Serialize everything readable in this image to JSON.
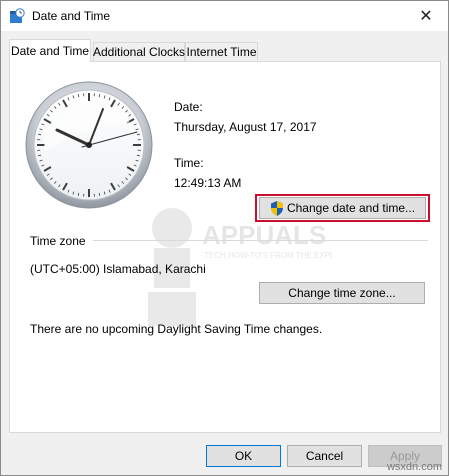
{
  "window": {
    "title": "Date and Time",
    "close_glyph": "✕"
  },
  "tabs": [
    {
      "label": "Date and Time",
      "active": true
    },
    {
      "label": "Additional Clocks",
      "active": false
    },
    {
      "label": "Internet Time",
      "active": false
    }
  ],
  "date": {
    "label": "Date:",
    "value": "Thursday, August 17, 2017"
  },
  "time": {
    "label": "Time:",
    "value": "12:49:13 AM"
  },
  "buttons": {
    "change_date_time": "Change date and time...",
    "change_time_zone": "Change time zone...",
    "ok": "OK",
    "cancel": "Cancel",
    "apply": "Apply"
  },
  "time_zone": {
    "heading": "Time zone",
    "value": "(UTC+05:00) Islamabad, Karachi"
  },
  "dst_message": "There are no upcoming Daylight Saving Time changes.",
  "watermark": {
    "brand": "APPUALS",
    "tagline": "TECH HOW-TO'S FROM THE EXPERTS!"
  },
  "site_mark": "wsxdn.com",
  "colors": {
    "highlight_border": "#c8102e",
    "shield_blue": "#1e5fb4",
    "shield_yellow": "#f2c200"
  },
  "icons": [
    "date-time-app-icon",
    "close-icon",
    "analog-clock-icon",
    "uac-shield-icon"
  ]
}
